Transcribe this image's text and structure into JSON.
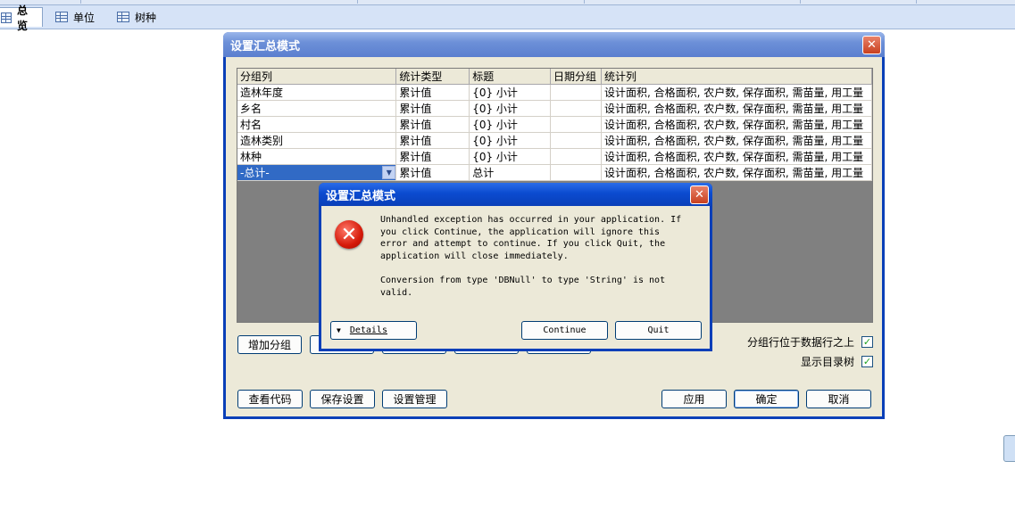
{
  "tabs": [
    {
      "label": "总览",
      "active": true
    },
    {
      "label": "单位",
      "active": false
    },
    {
      "label": "树种",
      "active": false
    }
  ],
  "main_dialog": {
    "title": "设置汇总模式",
    "columns": [
      "分组列",
      "统计类型",
      "标题",
      "日期分组",
      "统计列"
    ],
    "rows": [
      [
        "造林年度",
        "累计值",
        "{0} 小计",
        "",
        "设计面积, 合格面积, 农户数, 保存面积, 需苗量, 用工量"
      ],
      [
        "乡名",
        "累计值",
        "{0} 小计",
        "",
        "设计面积, 合格面积, 农户数, 保存面积, 需苗量, 用工量"
      ],
      [
        "村名",
        "累计值",
        "{0} 小计",
        "",
        "设计面积, 合格面积, 农户数, 保存面积, 需苗量, 用工量"
      ],
      [
        "造林类别",
        "累计值",
        "{0} 小计",
        "",
        "设计面积, 合格面积, 农户数, 保存面积, 需苗量, 用工量"
      ],
      [
        "林种",
        "累计值",
        "{0} 小计",
        "",
        "设计面积, 合格面积, 农户数, 保存面积, 需苗量, 用工量"
      ],
      [
        "-总计-",
        "累计值",
        "总计",
        "",
        "设计面积, 合格面积, 农户数, 保存面积, 需苗量, 用工量"
      ]
    ],
    "add_group_label": "增加分组",
    "checkbox_group_above": "分组行位于数据行之上",
    "checkbox_show_tree": "显示目录树",
    "view_code_label": "查看代码",
    "save_settings_label": "保存设置",
    "settings_manage_label": "设置管理",
    "apply_label": "应用",
    "ok_label": "确定",
    "cancel_label": "取消"
  },
  "error_dialog": {
    "title": "设置汇总模式",
    "message": "Unhandled exception has occurred in your application. If\nyou click Continue, the application will ignore this\nerror and attempt to continue. If you click Quit, the\napplication will close immediately.\n\nConversion from type 'DBNull' to type 'String' is not\nvalid.",
    "details_label": "Details",
    "continue_label": "Continue",
    "quit_label": "Quit"
  }
}
